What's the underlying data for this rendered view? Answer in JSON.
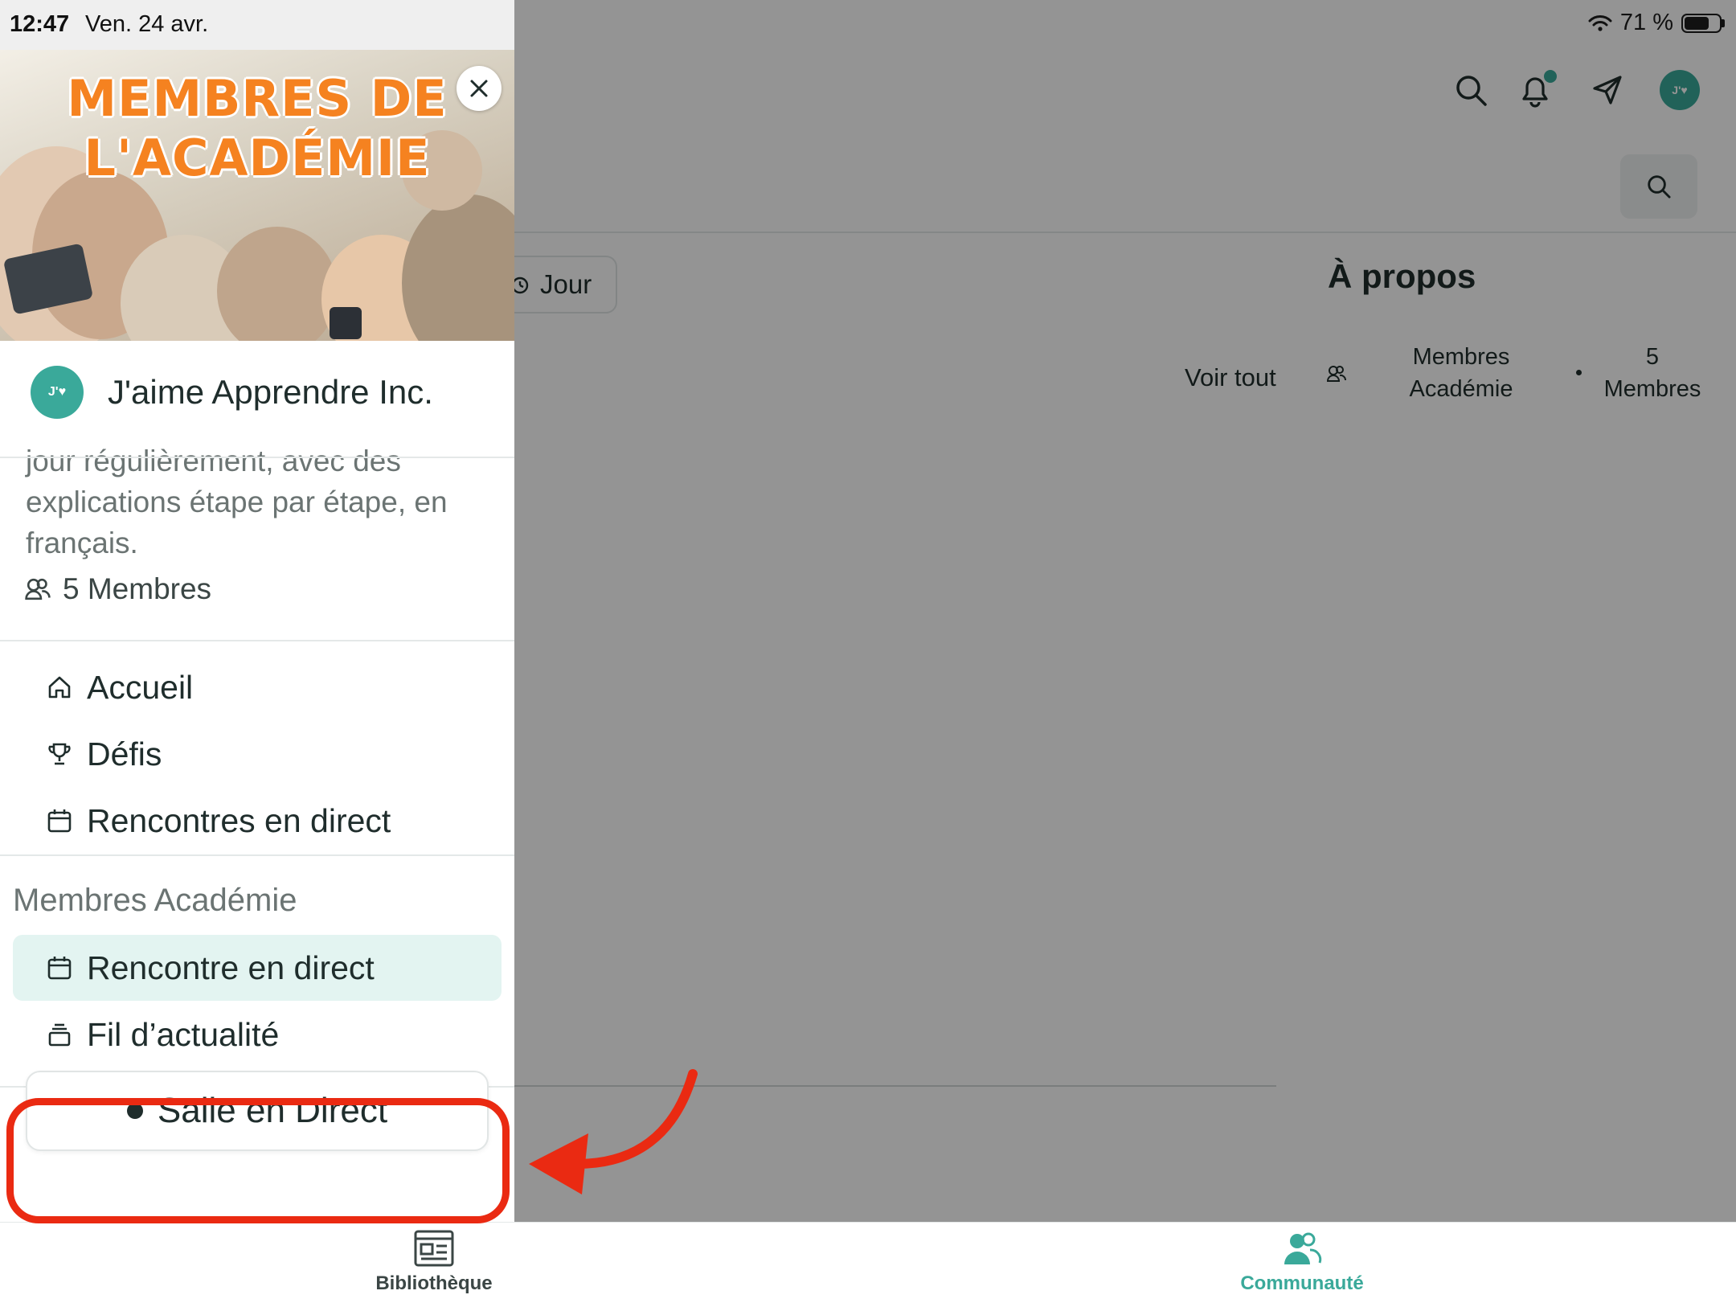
{
  "status_bar": {
    "time": "12:47",
    "date": "Ven. 24 avr.",
    "battery_text": "71 %",
    "battery_level": 0.71
  },
  "background_page": {
    "header_icons": [
      "search-icon",
      "bell-icon",
      "send-icon",
      "avatar"
    ],
    "avatar_initials": "J'♥",
    "jour_label": "Jour",
    "about_title": "À propos",
    "see_all": "Voir tout",
    "members_group_name": "Membres Académie",
    "members_count": "5 Membres"
  },
  "drawer": {
    "banner_title": "MEMBRES DE L'ACADÉMIE",
    "community_name": "J'aime Apprendre Inc.",
    "avatar_initials": "J'♥",
    "description": "jour régulièrement, avec des explications étape par étape, en français.",
    "members": "5 Membres",
    "nav": [
      {
        "label": "Accueil",
        "icon": "home-icon"
      },
      {
        "label": "Défis",
        "icon": "trophy-icon"
      },
      {
        "label": "Rencontres en direct",
        "icon": "calendar-icon"
      }
    ],
    "group_label": "Membres Académie",
    "group_nav": [
      {
        "label": "Rencontre en direct",
        "icon": "calendar-icon",
        "active": true
      },
      {
        "label": "Fil d’actualité",
        "icon": "feed-icon",
        "active": false
      }
    ],
    "live_button": "Salle en Direct"
  },
  "tabbar": {
    "tabs": [
      {
        "label": "Bibliothèque",
        "icon": "library-icon",
        "active": false
      },
      {
        "label": "Communauté",
        "icon": "community-icon",
        "active": true
      }
    ]
  },
  "colors": {
    "accent": "#3aa99a",
    "banner_title": "#f58220",
    "annotation": "#ea2a12",
    "active_nav_bg": "#e3f4f1"
  }
}
